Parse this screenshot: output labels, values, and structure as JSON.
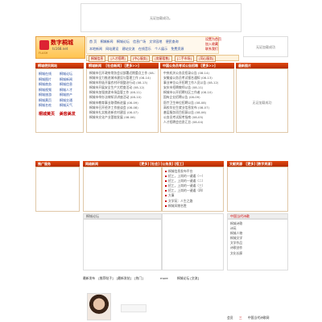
{
  "top_ad": "无证加载成功。",
  "side_ad_right": "无证加载成功",
  "logo": {
    "text": "数字桐城",
    "sub": "tc168.net",
    "flash": "FLASH"
  },
  "nav": {
    "row1": [
      "首 页",
      "桐城新闻",
      "桐城论坛",
      "信息广场",
      "文学园地",
      "便民查询",
      "健康养生",
      "文化生活"
    ],
    "row2": [
      "桐城新闻",
      "本地新闻",
      "网站建设",
      "建站交流",
      "在线音乐",
      "个人展示",
      "免费资源",
      "实用网址"
    ],
    "right": [
      "设置为首页",
      "加入收藏",
      "联系我们"
    ]
  },
  "tabs": {
    "left": "桐城信息",
    "items": [
      "[人才招聘]",
      "[中心服务]",
      "[房屋租售]",
      "[二手市场]",
      "[同心服务]"
    ]
  },
  "section_left": {
    "title": "桐城便民网站",
    "items": [
      {
        "a": "桐城在线",
        "b": "桐城论坛"
      },
      {
        "a": "桐城图片",
        "b": "桐城新闻"
      },
      {
        "a": "桐城商务",
        "b": "桐城信息"
      },
      {
        "a": "桐城视频",
        "b": "桐城人才"
      },
      {
        "a": "桐城旅游",
        "b": "桐城房产"
      },
      {
        "a": "桐城黄页",
        "b": "桐城交通"
      },
      {
        "a": "桐城名吃",
        "b": "桐城天气"
      }
    ],
    "badge1": "桐城黄页",
    "badge2": "美容美发"
  },
  "section_mid": {
    "title": "桐城新闻",
    "tabs": [
      "[社会新闻]",
      "[更多>>]"
    ],
    "items": [
      "桐城市召开政府常务会议部署近期重点工作 (08-14)",
      "桐城市全力推进城市建设与管理工作 (08-14)",
      "桐城市积极开展农村环境整治行动 (08-13)",
      "桐城市开展安全生产大检查活动 (08-12)",
      "桐城市加强旅游市场监管工作 (08-11)",
      "桐城市举办法律知识讲座活动 (08-10)",
      "桐城市教育事业取得新进展 (08-09)",
      "桐城市召开经济工作座谈会 (08-08)",
      "桐城市扎实推进新农村建设 (08-07)",
      "桐城市文化产业蓬勃发展 (08-06)"
    ]
  },
  "section_notice": {
    "title": "中国公务员考试公告招聘",
    "more": "[更多>>]",
    "items": [
      "中央机关公务员招录公告 (08-14)",
      "安徽省公务员考试报名通知 (08-13)",
      "事业单位公开招聘工作人员公告 (08-12)",
      "安庆市招聘教师公告 (08-11)",
      "桐城市公开招聘社区工作者 (08-10)",
      "国有企业招聘公告 (08-09)",
      "医疗卫生单位招聘公告 (08-08)",
      "高校毕业生就业信息发布 (08-07)",
      "基层服务项目招募公告 (08-06)",
      "公务员考试报考指南 (08-05)",
      "人才招聘会信息汇总 (08-04)"
    ]
  },
  "section_right": {
    "title": "最新图片"
  },
  "section_bottom_left": {
    "title": "推广服务"
  },
  "section_bottom_mid": {
    "title": "网络新闻",
    "tabs": [
      "[更多]",
      "[社会]",
      "[公务员]",
      "[招工]"
    ]
  },
  "section_bottom_right": {
    "title": "文献资源",
    "tabs": [
      "[更多]",
      "[数字资源]"
    ]
  },
  "list_links": [
    "桐城信息发布平台",
    "招工，上岗的一键通（一）",
    "招工，上岗的一键通（二）",
    "招工，上岗的一键通（三）",
    "招工，上岗的一键通（四）",
    "大事",
    "文学苑：人生之路",
    "桐城风物名胜",
    "在线游戏专区",
    "家庭生活助手",
    "新闻与资讯的互动平台"
  ],
  "section_forum": {
    "title": "桐城论坛"
  },
  "section_culture": {
    "title": "中国当代诗歌",
    "items": [
      "桐城诗歌",
      "诗苑",
      "桐城人物",
      "桐城文学",
      "文学作品",
      "诗歌创作",
      "文化长廊"
    ]
  },
  "bottom_tabs": [
    "最新发布",
    "[推荐帖子]",
    "[最新发帖]",
    "[热门]",
    "more"
  ],
  "bottom_tabs_right": [
    "桐城论坛",
    "[交流]"
  ],
  "footer_right": [
    "会员",
    "三",
    "中国当代诗歌网"
  ]
}
